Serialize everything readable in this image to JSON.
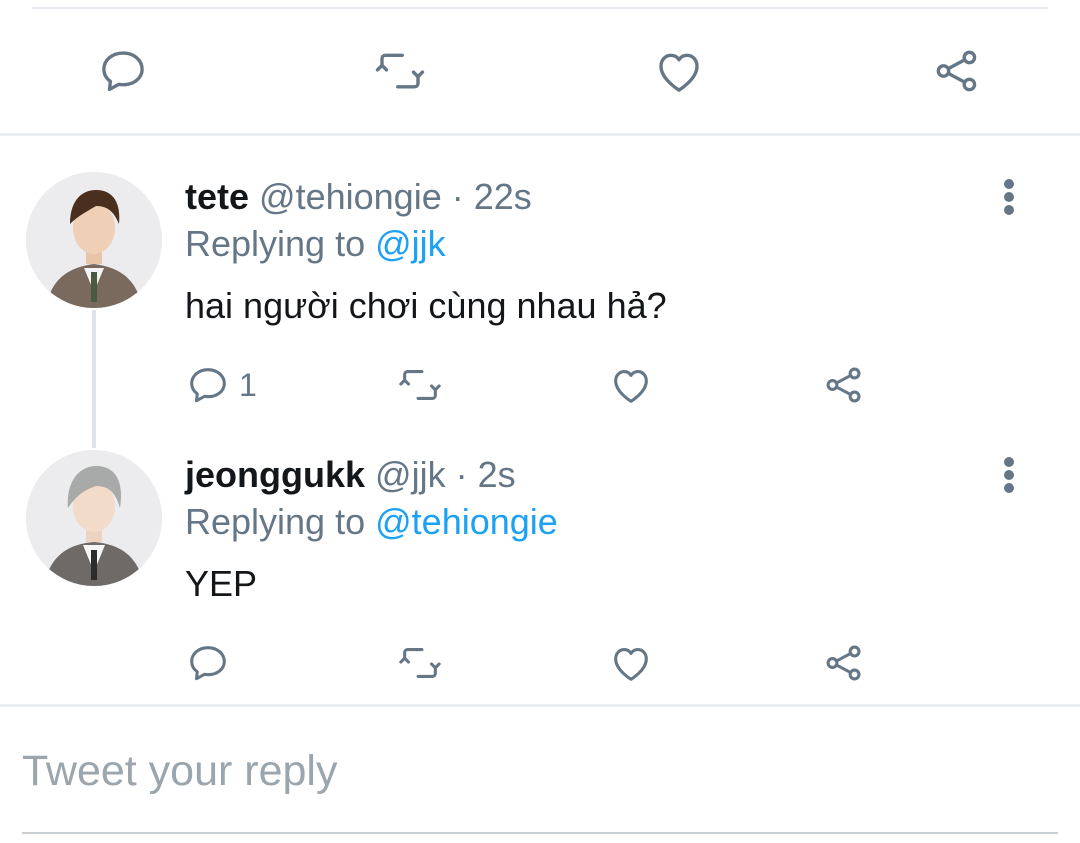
{
  "colors": {
    "accent": "#1da1f2",
    "icon": "#657786",
    "text": "#14171a",
    "placeholder": "#9aa5ad"
  },
  "top_actions": {
    "icons": [
      "reply-icon",
      "retweet-icon",
      "like-icon",
      "share-icon"
    ]
  },
  "tweets": [
    {
      "name": "tete",
      "handle": "@tehiongie",
      "separator": "·",
      "time": "22s",
      "replying_prefix": "Replying to",
      "replying_to": "@jjk",
      "text": "hai người chơi cùng nhau hả?",
      "reply_count": "1",
      "avatar": "avatar-photo"
    },
    {
      "name": "jeonggukk",
      "handle": "@jjk",
      "separator": "·",
      "time": "2s",
      "replying_prefix": "Replying to",
      "replying_to": "@tehiongie",
      "text": "YEP",
      "reply_count": "",
      "avatar": "avatar-photo"
    }
  ],
  "compose": {
    "placeholder": "Tweet your reply"
  }
}
